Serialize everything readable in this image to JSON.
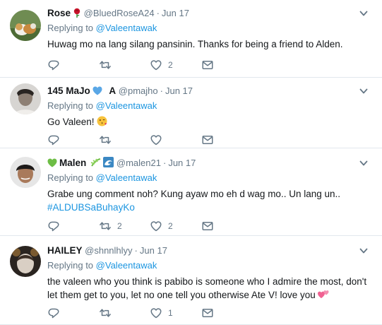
{
  "tweets": [
    {
      "name": "Rose",
      "name_emoji": "rose",
      "handle": "@BluedRoseA24",
      "date": "Jun 17",
      "replying_prefix": "Replying to",
      "replying_to": "@Valeentawak",
      "text": "Huwag mo na lang silang pansinin. Thanks for being a friend to Alden.",
      "hashtag": "",
      "reply_count": "",
      "retweet_count": "",
      "like_count": "2"
    },
    {
      "name": "145 MaJo",
      "name_suffix": "A",
      "name_emoji": "blue-heart",
      "handle": "@pmajho",
      "date": "Jun 17",
      "replying_prefix": "Replying to",
      "replying_to": "@Valeentawak",
      "text": "Go Valeen!",
      "text_emoji": "kissing-face",
      "hashtag": "",
      "reply_count": "",
      "retweet_count": "",
      "like_count": ""
    },
    {
      "name": "Malen",
      "name_emoji": "green-heart, sparkles, wave",
      "handle": "@malen21",
      "date": "Jun 17",
      "replying_prefix": "Replying to",
      "replying_to": "@Valeentawak",
      "text": "Grabe ung comment noh? Kung ayaw mo eh d wag mo..  Un lang un..",
      "hashtag": "#ALDUBSaBuhayKo",
      "reply_count": "",
      "retweet_count": "2",
      "like_count": "2"
    },
    {
      "name": "HAILEY",
      "handle": "@shnnlhlyy",
      "date": "Jun 17",
      "replying_prefix": "Replying to",
      "replying_to": "@Valeentawak",
      "text": "the valeen who you think is pabibo is someone who I admire the most, don't let them get to you, let no one tell you otherwise Ate V! love you",
      "text_emoji": "two-hearts",
      "hashtag": "",
      "reply_count": "",
      "retweet_count": "",
      "like_count": "1"
    }
  ],
  "icons": {
    "reply": "reply-icon",
    "retweet": "retweet-icon",
    "like": "heart-icon",
    "dm": "envelope-icon",
    "more": "chevron-down-icon"
  },
  "colors": {
    "text": "#14171a",
    "secondary": "#657786",
    "link": "#1b95e0",
    "divider": "#e1e8ed"
  }
}
